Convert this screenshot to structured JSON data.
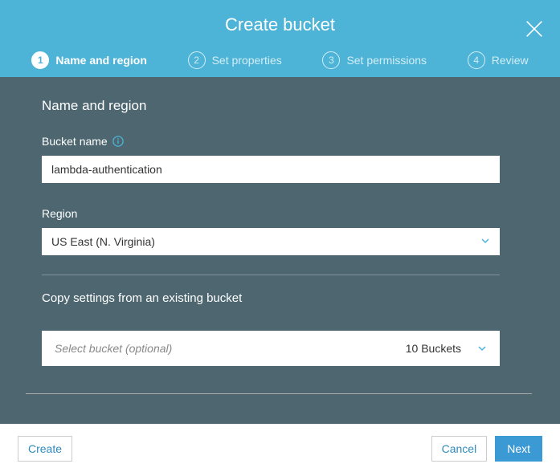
{
  "header": {
    "title": "Create bucket"
  },
  "steps": [
    {
      "num": "1",
      "label": "Name and region",
      "active": true
    },
    {
      "num": "2",
      "label": "Set properties",
      "active": false
    },
    {
      "num": "3",
      "label": "Set permissions",
      "active": false
    },
    {
      "num": "4",
      "label": "Review",
      "active": false
    }
  ],
  "form": {
    "section_title": "Name and region",
    "bucket_name_label": "Bucket name",
    "bucket_name_value": "lambda-authentication",
    "region_label": "Region",
    "region_value": "US East (N. Virginia)",
    "copy_section_title": "Copy settings from an existing bucket",
    "copy_placeholder": "Select bucket (optional)",
    "copy_count": "10 Buckets"
  },
  "footer": {
    "create": "Create",
    "cancel": "Cancel",
    "next": "Next"
  }
}
